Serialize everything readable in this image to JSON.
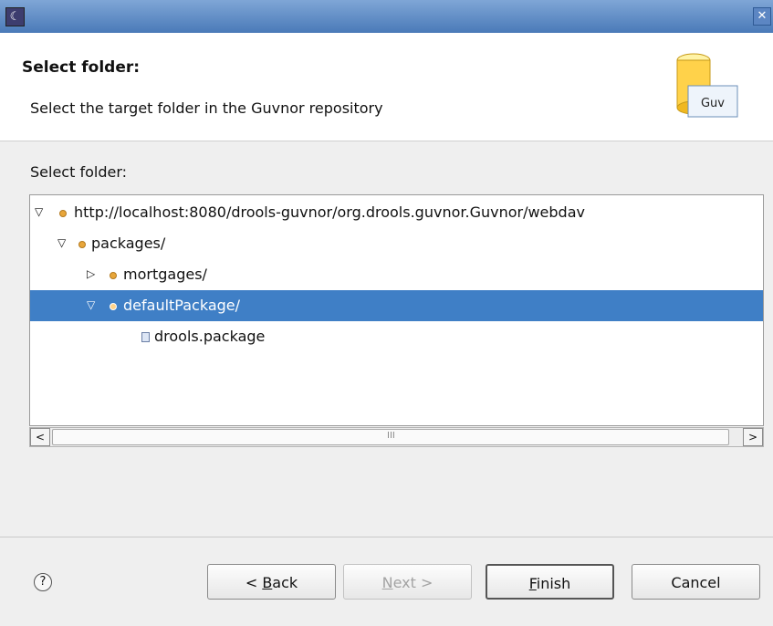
{
  "window": {
    "icon": "eclipse-icon",
    "close_icon": "close-icon"
  },
  "header": {
    "title": "Select folder:",
    "description": "Select the target folder in the Guvnor repository",
    "banner_label": "Guv",
    "banner_icon": "guvnor-database-icon"
  },
  "tree_label": "Select folder:",
  "tree": {
    "items": [
      {
        "label": "http://localhost:8080/drools-guvnor/org.drools.guvnor.Guvnor/webdav",
        "expanded": true,
        "icon": "folder-icon"
      },
      {
        "label": "packages/",
        "expanded": true,
        "icon": "folder-icon"
      },
      {
        "label": "mortgages/",
        "expanded": false,
        "icon": "folder-icon"
      },
      {
        "label": "defaultPackage/",
        "expanded": true,
        "selected": true,
        "icon": "folder-icon"
      },
      {
        "label": "drools.package",
        "icon": "file-icon"
      }
    ]
  },
  "scrollbar": {
    "left_arrow": "<",
    "right_arrow": ">",
    "grip": "III"
  },
  "footer": {
    "help_icon": "help-icon",
    "back_mnemonic": "B",
    "back_rest": "ack",
    "back_prefix": "< ",
    "next_mnemonic": "N",
    "next_rest": "ext >",
    "finish_mnemonic": "F",
    "finish_rest": "inish",
    "cancel_label": "Cancel",
    "colors": {
      "selection": "#3f7fc6",
      "titlebar": "#4a7ab8"
    }
  }
}
